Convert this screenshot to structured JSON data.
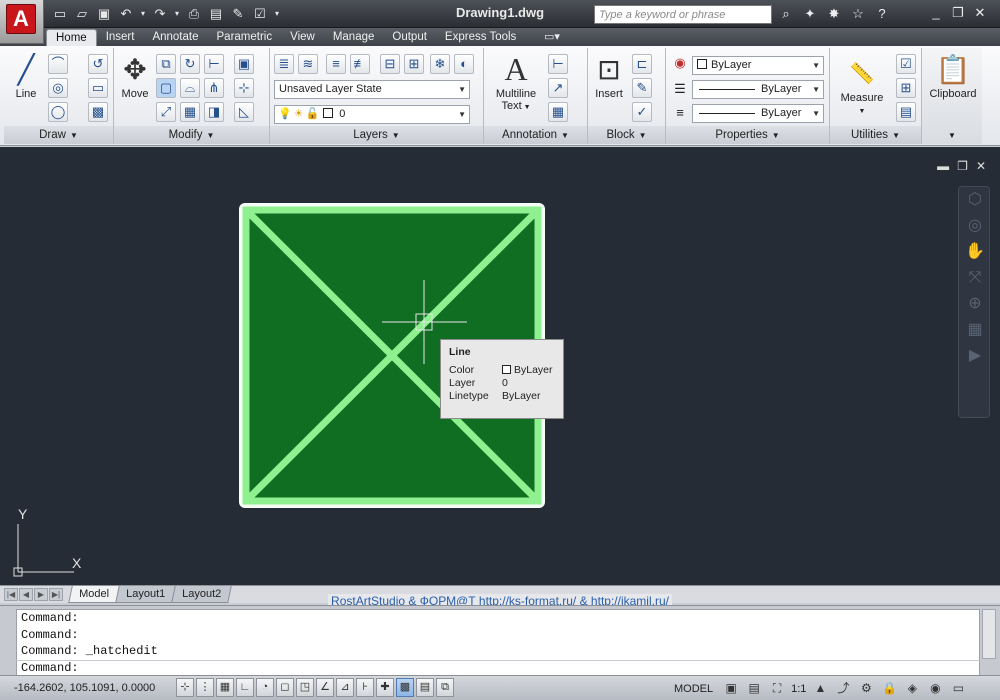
{
  "app": {
    "logo_letter": "A",
    "title": "Drawing1.dwg"
  },
  "quick_access": [
    "new-icon",
    "open-icon",
    "save-icon",
    "undo-icon",
    "redo-icon",
    "plot-icon",
    "publish-icon",
    "properties-icon"
  ],
  "search": {
    "placeholder": "Type a keyword or phrase"
  },
  "tabs": [
    "Home",
    "Insert",
    "Annotate",
    "Parametric",
    "View",
    "Manage",
    "Output",
    "Express Tools"
  ],
  "active_tab": "Home",
  "panels": {
    "draw": {
      "label": "Draw",
      "line_label": "Line"
    },
    "modify": {
      "label": "Modify",
      "move_label": "Move"
    },
    "layers": {
      "label": "Layers",
      "layer_state": "Unsaved Layer State",
      "current_layer": "0"
    },
    "annotation": {
      "label": "Annotation",
      "mtext_label_1": "Multiline",
      "mtext_label_2": "Text"
    },
    "block": {
      "label": "Block",
      "insert_label": "Insert"
    },
    "properties": {
      "label": "Properties",
      "color": "ByLayer",
      "linetype": "ByLayer",
      "lineweight": "ByLayer"
    },
    "utilities": {
      "label": "Utilities",
      "measure_label": "Measure"
    },
    "clipboard": {
      "label": "Clipboard"
    }
  },
  "tooltip": {
    "title": "Line",
    "rows": [
      {
        "key": "Color",
        "value": "ByLayer"
      },
      {
        "key": "Layer",
        "value": "0"
      },
      {
        "key": "Linetype",
        "value": "ByLayer"
      }
    ]
  },
  "ucs": {
    "x_label": "X",
    "y_label": "Y"
  },
  "layout_tabs": [
    "Model",
    "Layout1",
    "Layout2"
  ],
  "active_layout": "Model",
  "credits": "RostArtStudio & ФОРМ@Т http://ks-format.ru/ & http://ikamil.ru/",
  "command_history": [
    "Command:",
    "Command:",
    "Command: _hatchedit"
  ],
  "command_prompt": "Command:",
  "status": {
    "coordinates": "-164.2602, 105.1091, 0.0000",
    "space": "MODEL",
    "annotation_scale": "1:1"
  },
  "colors": {
    "hatch_fill": "#0f6e22",
    "hatch_lines": "#8ff08f",
    "canvas": "#252c36",
    "accent": "#c8161b"
  }
}
